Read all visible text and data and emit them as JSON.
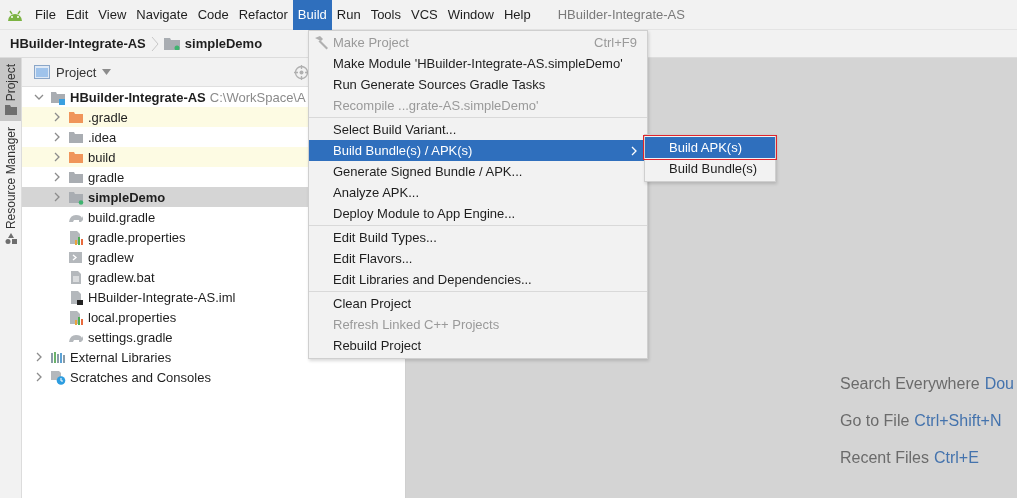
{
  "menubar": {
    "items": [
      {
        "label": "File",
        "selected": false
      },
      {
        "label": "Edit",
        "selected": false
      },
      {
        "label": "View",
        "selected": false
      },
      {
        "label": "Navigate",
        "selected": false
      },
      {
        "label": "Code",
        "selected": false
      },
      {
        "label": "Refactor",
        "selected": false
      },
      {
        "label": "Build",
        "selected": true
      },
      {
        "label": "Run",
        "selected": false
      },
      {
        "label": "Tools",
        "selected": false
      },
      {
        "label": "VCS",
        "selected": false
      },
      {
        "label": "Window",
        "selected": false
      },
      {
        "label": "Help",
        "selected": false
      }
    ],
    "title": "HBuilder-Integrate-AS"
  },
  "breadcrumb": [
    {
      "label": "HBuilder-Integrate-AS",
      "kind": "project"
    },
    {
      "label": "simpleDemo",
      "kind": "module"
    }
  ],
  "tool_stripe": [
    {
      "label": "Project",
      "selected": true,
      "kind": "folder"
    },
    {
      "label": "Resource Manager",
      "selected": false,
      "kind": "shapes"
    }
  ],
  "project_panel": {
    "title": "Project",
    "tree": [
      {
        "label": "HBuilder-Integrate-AS",
        "path": "C:\\WorkSpace\\A",
        "kind": "project",
        "expanded": true,
        "highlighted": false,
        "selected": false,
        "children": [
          {
            "label": ".gradle",
            "kind": "folder-excluded",
            "expanded": false,
            "highlighted": true,
            "selected": false
          },
          {
            "label": ".idea",
            "kind": "folder",
            "expanded": false,
            "highlighted": false,
            "selected": false
          },
          {
            "label": "build",
            "kind": "folder-excluded",
            "expanded": false,
            "highlighted": true,
            "selected": false
          },
          {
            "label": "gradle",
            "kind": "folder",
            "expanded": false,
            "highlighted": false,
            "selected": false
          },
          {
            "label": "simpleDemo",
            "kind": "module",
            "expanded": false,
            "highlighted": false,
            "selected": true
          },
          {
            "label": "build.gradle",
            "kind": "gradle",
            "highlighted": false,
            "selected": false
          },
          {
            "label": "gradle.properties",
            "kind": "properties",
            "highlighted": false,
            "selected": false
          },
          {
            "label": "gradlew",
            "kind": "script",
            "highlighted": false,
            "selected": false
          },
          {
            "label": "gradlew.bat",
            "kind": "text",
            "highlighted": false,
            "selected": false
          },
          {
            "label": "HBuilder-Integrate-AS.iml",
            "kind": "iml",
            "highlighted": false,
            "selected": false
          },
          {
            "label": "local.properties",
            "kind": "properties",
            "highlighted": false,
            "selected": false
          },
          {
            "label": "settings.gradle",
            "kind": "gradle",
            "highlighted": false,
            "selected": false
          }
        ]
      },
      {
        "label": "External Libraries",
        "kind": "libraries",
        "expanded": false,
        "highlighted": false,
        "selected": false
      },
      {
        "label": "Scratches and Consoles",
        "kind": "scratches",
        "expanded": false,
        "highlighted": false,
        "selected": false
      }
    ]
  },
  "build_menu": {
    "groups": [
      [
        {
          "label": "Make Project",
          "shortcut": "Ctrl+F9",
          "kind": "hammer",
          "disabled": true,
          "selected": false,
          "submenu": false
        },
        {
          "label": "Make Module 'HBuilder-Integrate-AS.simpleDemo'",
          "kind": "plain",
          "disabled": false,
          "selected": false,
          "submenu": false
        },
        {
          "label": "Run Generate Sources Gradle Tasks",
          "kind": "plain",
          "disabled": false,
          "selected": false,
          "submenu": false
        },
        {
          "label": "Recompile ...grate-AS.simpleDemo'",
          "kind": "plain",
          "disabled": true,
          "selected": false,
          "submenu": false
        }
      ],
      [
        {
          "label": "Select Build Variant...",
          "kind": "plain",
          "disabled": false,
          "selected": false,
          "submenu": false
        },
        {
          "label": "Build Bundle(s) / APK(s)",
          "kind": "plain",
          "disabled": false,
          "selected": true,
          "submenu": true
        },
        {
          "label": "Generate Signed Bundle / APK...",
          "kind": "plain",
          "disabled": false,
          "selected": false,
          "submenu": false
        },
        {
          "label": "Analyze APK...",
          "kind": "plain",
          "disabled": false,
          "selected": false,
          "submenu": false
        },
        {
          "label": "Deploy Module to App Engine...",
          "kind": "plain",
          "disabled": false,
          "selected": false,
          "submenu": false
        }
      ],
      [
        {
          "label": "Edit Build Types...",
          "kind": "plain",
          "disabled": false,
          "selected": false,
          "submenu": false
        },
        {
          "label": "Edit Flavors...",
          "kind": "plain",
          "disabled": false,
          "selected": false,
          "submenu": false
        },
        {
          "label": "Edit Libraries and Dependencies...",
          "kind": "plain",
          "disabled": false,
          "selected": false,
          "submenu": false
        }
      ],
      [
        {
          "label": "Clean Project",
          "kind": "plain",
          "disabled": false,
          "selected": false,
          "submenu": false
        },
        {
          "label": "Refresh Linked C++ Projects",
          "kind": "plain",
          "disabled": true,
          "selected": false,
          "submenu": false
        },
        {
          "label": "Rebuild Project",
          "kind": "plain",
          "disabled": false,
          "selected": false,
          "submenu": false
        }
      ]
    ]
  },
  "submenu": {
    "items": [
      {
        "label": "Build APK(s)",
        "selected": true,
        "outlined": true
      },
      {
        "label": "Build Bundle(s)",
        "selected": false,
        "outlined": false
      }
    ]
  },
  "editor_hints": [
    {
      "label": "Search Everywhere",
      "shortcut": "Dou"
    },
    {
      "label": "Go to File",
      "shortcut": "Ctrl+Shift+N"
    },
    {
      "label": "Recent Files",
      "shortcut": "Ctrl+E"
    }
  ]
}
